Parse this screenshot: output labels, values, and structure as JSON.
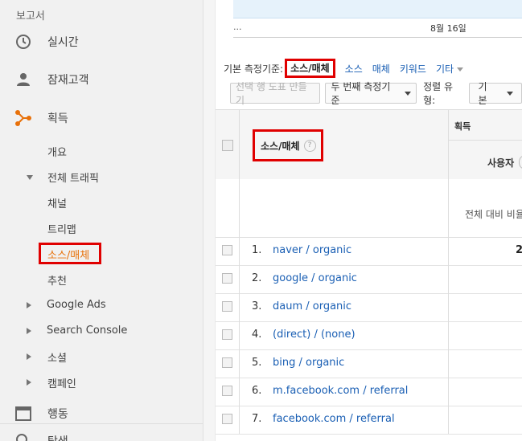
{
  "sidebar": {
    "header": "보고서",
    "realtime": "실시간",
    "audience": "잠재고객",
    "acquisition": "획득",
    "overview": "개요",
    "all_traffic": "전체 트래픽",
    "channels": "채널",
    "treemap": "트리맵",
    "source_medium": "소스/매체",
    "referrals": "추천",
    "google_ads": "Google Ads",
    "search_console": "Search Console",
    "social": "소셜",
    "campaigns": "캠페인",
    "behavior": "행동",
    "discover": "탐색"
  },
  "chart": {
    "ellipsis": "...",
    "date_label": "8월 16일"
  },
  "dimension_bar": {
    "label": "기본 측정기준:",
    "active": "소스/매체",
    "options": [
      "소스",
      "매체",
      "키워드"
    ],
    "other": "기타"
  },
  "toolbar": {
    "plot_rows": "선택 행 도표 만들기",
    "secondary_dimension": "두 번째 측정기준",
    "sort_label": "정렬 유형:",
    "sort_value": "기본"
  },
  "table": {
    "dimension_header": "소스/매체",
    "help": "?",
    "acquisition_header": "획득",
    "users_header": "사용자",
    "percent_of_total": "전체 대비 비율",
    "rows": [
      {
        "num": "1.",
        "name": "naver / organic",
        "value": "2"
      },
      {
        "num": "2.",
        "name": "google / organic",
        "value": ""
      },
      {
        "num": "3.",
        "name": "daum / organic",
        "value": ""
      },
      {
        "num": "4.",
        "name": "(direct) / (none)",
        "value": ""
      },
      {
        "num": "5.",
        "name": "bing / organic",
        "value": ""
      },
      {
        "num": "6.",
        "name": "m.facebook.com / referral",
        "value": ""
      },
      {
        "num": "7.",
        "name": "facebook.com / referral",
        "value": ""
      }
    ]
  },
  "colors": {
    "accent_orange": "#e8710a",
    "highlight_red": "#e00000",
    "link_blue": "#1a5fb4"
  }
}
